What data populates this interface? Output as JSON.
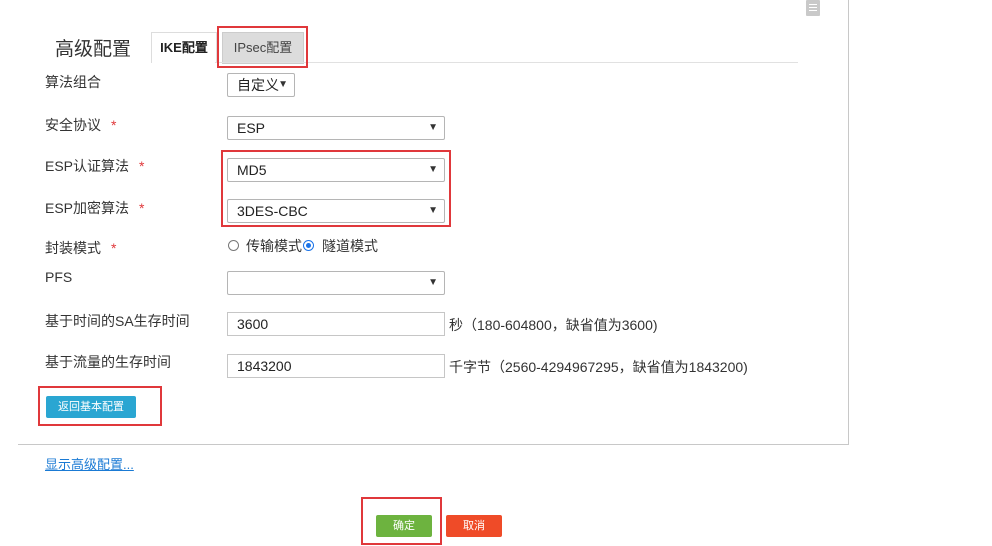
{
  "panel_title": "高级配置",
  "tabs": [
    {
      "label": "IKE配置",
      "active": true
    },
    {
      "label": "IPsec配置",
      "active": false
    }
  ],
  "fields": {
    "algo_combo": {
      "label": "算法组合",
      "value": "自定义"
    },
    "security_protocol": {
      "label": "安全协议",
      "required": "*",
      "value": "ESP"
    },
    "esp_auth": {
      "label": "ESP认证算法",
      "required": "*",
      "value": "MD5"
    },
    "esp_encrypt": {
      "label": "ESP加密算法",
      "required": "*",
      "value": "3DES-CBC"
    },
    "encap_mode": {
      "label": "封装模式",
      "required": "*",
      "options": [
        "传输模式",
        "隧道模式"
      ],
      "selected": "隧道模式"
    },
    "pfs": {
      "label": "PFS",
      "value": ""
    },
    "sa_time": {
      "label": "基于时间的SA生存时间",
      "value": "3600",
      "hint": "秒（180-604800，缺省值为3600)"
    },
    "sa_traffic": {
      "label": "基于流量的生存时间",
      "value": "1843200",
      "hint": "千字节（2560-4294967295，缺省值为1843200)"
    }
  },
  "buttons": {
    "back": "返回基本配置",
    "ok": "确定",
    "cancel": "取消"
  },
  "links": {
    "show_advanced": "显示高级配置..."
  },
  "colors": {
    "highlight": "#e0383b",
    "ok_button": "#6db33f",
    "cancel_button": "#ef4b28",
    "back_button": "#2aa6d2",
    "link": "#1a7ad4"
  }
}
